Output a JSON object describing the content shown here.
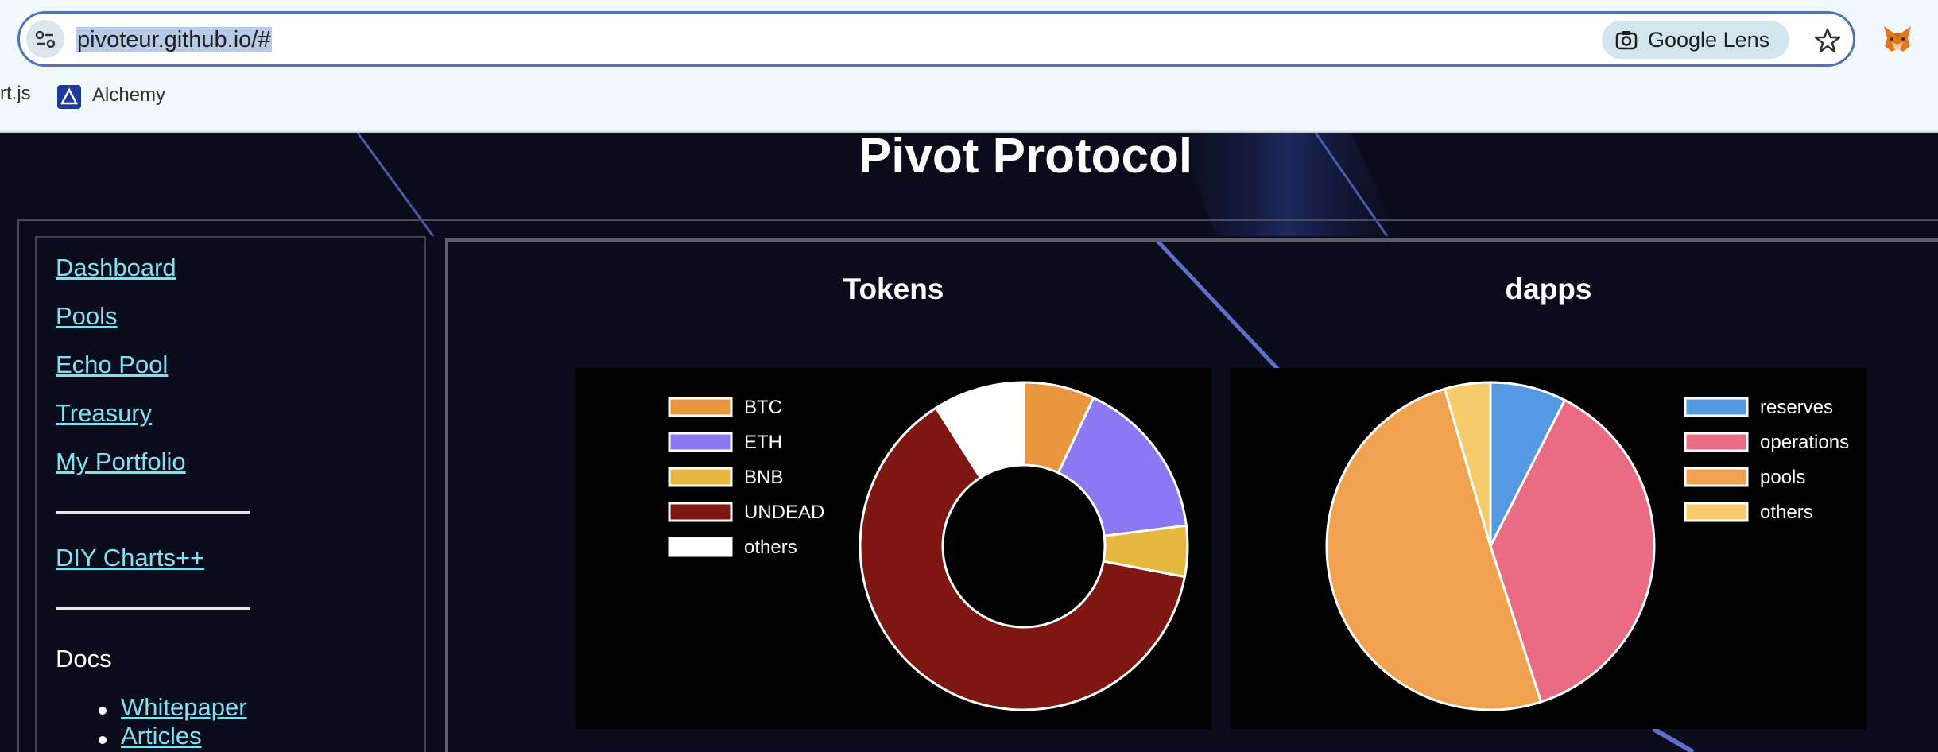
{
  "browser": {
    "url": "pivoteur.github.io/#",
    "lens_label": "Google Lens",
    "bookmarks": [
      {
        "label": "rt.js"
      },
      {
        "label": "Alchemy"
      }
    ]
  },
  "page": {
    "title": "Pivot Protocol"
  },
  "sidebar": {
    "links": [
      {
        "label": "Dashboard"
      },
      {
        "label": "Pools"
      },
      {
        "label": "Echo Pool"
      },
      {
        "label": "Treasury"
      },
      {
        "label": "My Portfolio"
      }
    ],
    "diy_link": "DIY Charts++",
    "docs_label": "Docs",
    "docs_links": [
      {
        "label": "Whitepaper"
      },
      {
        "label": "Articles"
      }
    ]
  },
  "chart_data": [
    {
      "type": "pie",
      "variant": "doughnut",
      "title": "Tokens",
      "labels": [
        "BTC",
        "ETH",
        "BNB",
        "UNDEAD",
        "others"
      ],
      "values": [
        7,
        16,
        5,
        63,
        9
      ],
      "colors": [
        "#e8973f",
        "#8b78f2",
        "#e6b840",
        "#7e1711",
        "#ffffff"
      ],
      "legend": "left"
    },
    {
      "type": "pie",
      "title": "dapps",
      "labels": [
        "reserves",
        "operations",
        "pools",
        "others"
      ],
      "values": [
        7.5,
        37.5,
        50.5,
        4.5
      ],
      "colors": [
        "#5499e1",
        "#ea6c84",
        "#f0a251",
        "#f6cc6b"
      ],
      "legend": "right"
    }
  ]
}
